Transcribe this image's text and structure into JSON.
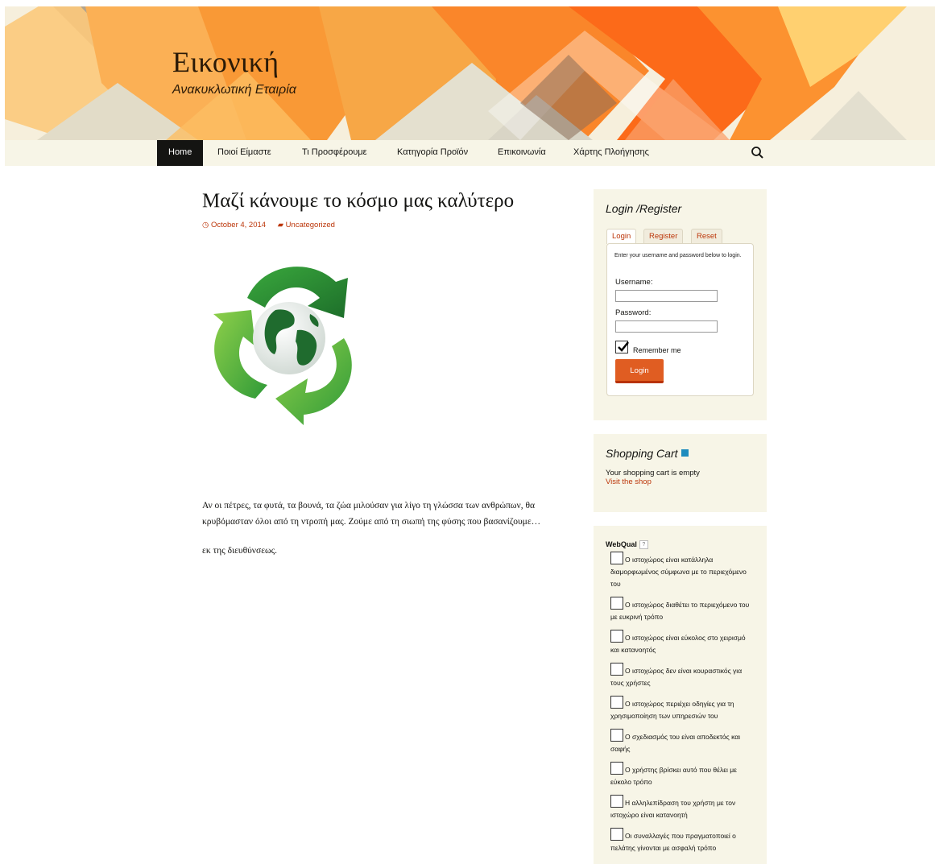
{
  "site": {
    "title": "Εικονική",
    "description": "Ανακυκλωτική Εταιρία"
  },
  "nav": {
    "items": [
      "Home",
      "Ποιοί Είμαστε",
      "Τι Προσφέρουμε",
      "Κατηγορία Προϊόν",
      "Επικοινωνία",
      "Χάρτης Πλοήγησης"
    ],
    "active_index": 0,
    "search_icon": "search-icon"
  },
  "post": {
    "title": "Μαζί κάνουμε το κόσμο μας καλύτερο",
    "date": "October 4, 2014",
    "category": "Uncategorized",
    "image": "recycle-globe",
    "paragraphs": [
      "Αν οι πέτρες, τα φυτά, τα βουνά, τα ζώα μιλούσαν για λίγο τη γλώσσα των ανθρώπων, θα κρυβόμασταν όλοι από τη ντροπή μας. Ζούμε από τη σιωπή της φύσης που βασανίζουμε…",
      "εκ της διευθύνσεως."
    ]
  },
  "login_widget": {
    "title": "Login /Register",
    "tabs": [
      "Login",
      "Register",
      "Reset"
    ],
    "intro": "Enter your username and password below to login.",
    "username_label": "Username:",
    "username_value": "",
    "password_label": "Password:",
    "password_value": "",
    "remember_label": "Remember me",
    "remember_checked": true,
    "button": "Login"
  },
  "cart_widget": {
    "title": "Shopping Cart",
    "empty_text": "Your shopping cart is empty",
    "link": "Visit the shop"
  },
  "webqual_widget": {
    "title": "WebQual",
    "help": "?",
    "items": [
      "Ο ιστοχώρος είναι κατάλληλα διαμορφωμένος σύμφωνα με το περιεχόμενο του",
      "Ο ιστοχώρος διαθέτει το περιεχόμενο του με ευκρινή τρόπο",
      "Ο ιστοχώρος είναι εύκολος στο χειρισμό και κατανοητός",
      "Ο ιστοχώρος δεν είναι κουραστικός για τους χρήστες",
      "Ο ιστοχώρος περιέχει οδηγίες για τη χρησιμοποίηση των υπηρεσιών του",
      "Ο σχεδιασμός του είναι αποδεκτός και σαφής",
      "Ο χρήστης βρίσκει αυτό που θέλει με εύκολο τρόπο",
      "Η αλληλεπίδραση του χρήστη με τον ιστοχώρο είναι κατανοητή",
      "Οι συναλλαγές που πραγματοποιεί ο πελάτης γίνονται με ασφαλή τρόπο"
    ]
  },
  "colors": {
    "accent": "#bc360a",
    "button": "#e05d22",
    "widget_bg": "#f7f5e7",
    "nav_active": "#141412"
  }
}
